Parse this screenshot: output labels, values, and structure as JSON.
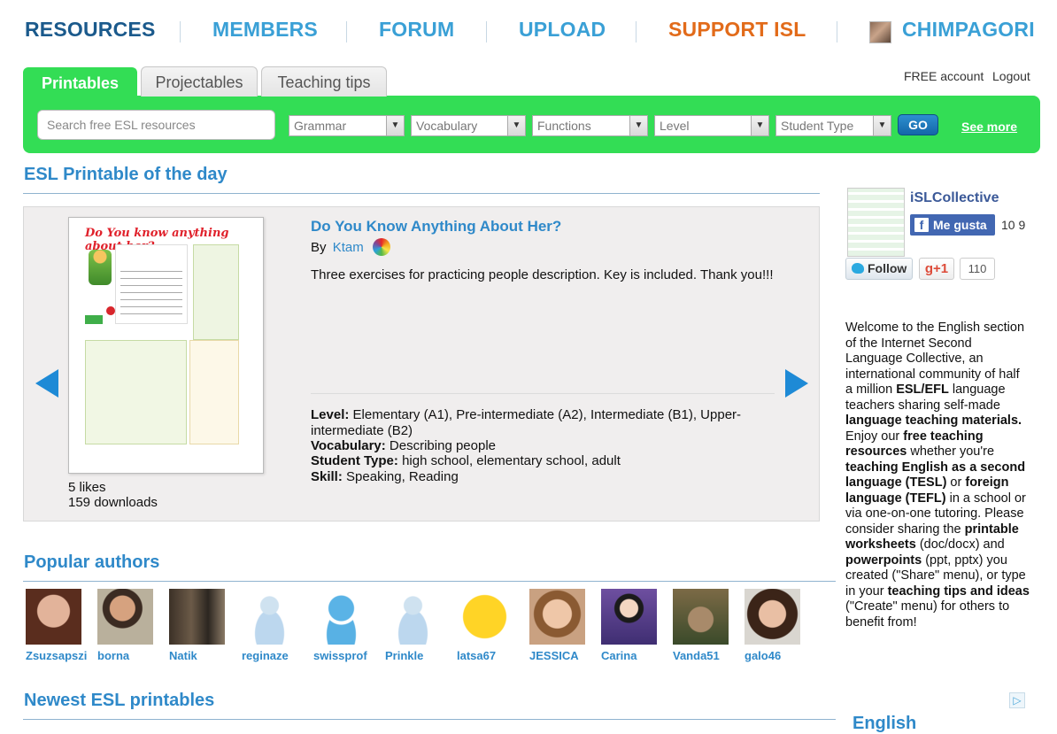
{
  "nav": {
    "resources": "RESOURCES",
    "members": "MEMBERS",
    "forum": "FORUM",
    "upload": "UPLOAD",
    "support": "SUPPORT ISL",
    "user": "CHIMPAGORI",
    "resources_color": "#1b5a8c",
    "link_color": "#3aa0d6",
    "support_color": "#e26b1a"
  },
  "account": {
    "free": "FREE account",
    "logout": "Logout"
  },
  "tabs": [
    {
      "label": "Printables",
      "active": true
    },
    {
      "label": "Projectables",
      "active": false
    },
    {
      "label": "Teaching tips",
      "active": false
    }
  ],
  "search": {
    "placeholder": "Search free ESL resources",
    "filters": [
      "Grammar",
      "Vocabulary",
      "Functions",
      "Level",
      "Student Type"
    ],
    "go": "GO",
    "see_more": "See more"
  },
  "potd": {
    "section_title": "ESL Printable of the day",
    "title": "Do You Know Anything About Her?",
    "by": "By",
    "author": "Ktam",
    "description": "Three exercises for practicing people description. Key is included. Thank you!!!",
    "worksheet_title": "Do You know anything about her?",
    "level_label": "Level:",
    "level": "Elementary (A1), Pre-intermediate (A2), Intermediate (B1), Upper-intermediate (B2)",
    "vocab_label": "Vocabulary:",
    "vocab": "Describing people",
    "student_label": "Student Type:",
    "student": "high school, elementary school, adult",
    "skill_label": "Skill:",
    "skill": "Speaking, Reading",
    "likes": "5 likes",
    "downloads": "159 downloads"
  },
  "popular": {
    "title": "Popular authors",
    "authors": [
      "Zsuzsapszi",
      "borna",
      "Natik",
      "reginaze",
      "swissprof",
      "Prinkle",
      "latsa67",
      "JESSICA",
      "Carina",
      "Vanda51",
      "galo46"
    ]
  },
  "newest": {
    "title": "Newest ESL printables"
  },
  "sidebar": {
    "site": "iSLCollective",
    "like": "Me gusta",
    "like_count": "10 9",
    "follow": "Follow",
    "gplus": "g+1",
    "gplus_count": "110",
    "welcome": {
      "p1": "Welcome to the English section of the Internet Second Language Collective, an international community of half a million ",
      "b1": "ESL/EFL",
      "p2": " language teachers sharing self-made ",
      "b2": "language teaching materials.",
      "p3": " Enjoy our ",
      "b3": "free teaching resources",
      "p4": " whether you're ",
      "b4": "teaching English as a second language (TESL)",
      "p5": " or ",
      "b5": "foreign language (TEFL)",
      "p6": " in a school or via one-on-one tutoring. Please consider sharing the ",
      "b6": "printable worksheets",
      "p7": " (doc/docx) and ",
      "b7": "powerpoints",
      "p8": " (ppt, pptx) you created (\"Share\" menu), or type in your ",
      "b8": "teaching tips and ideas",
      "p9": " (\"Create\" menu) for others to benefit from!"
    },
    "next_heading": "English"
  },
  "icons": {
    "prev": "arrow-left-icon",
    "next": "arrow-right-icon",
    "adchoices": "adchoices-icon"
  }
}
